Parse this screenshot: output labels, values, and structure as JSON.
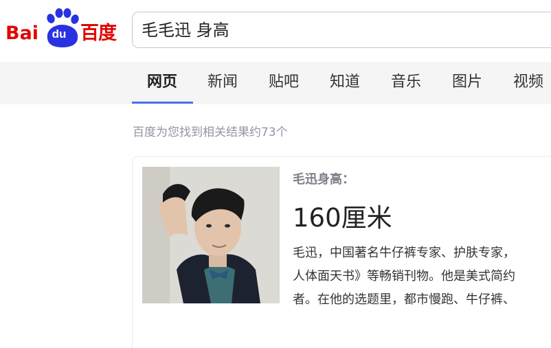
{
  "logo": {
    "bai": "Bai",
    "du": "du",
    "cn": "百度"
  },
  "search": {
    "query": "毛毛迅 身高"
  },
  "tabs": [
    {
      "label": "网页",
      "active": true
    },
    {
      "label": "新闻",
      "active": false
    },
    {
      "label": "贴吧",
      "active": false
    },
    {
      "label": "知道",
      "active": false
    },
    {
      "label": "音乐",
      "active": false
    },
    {
      "label": "图片",
      "active": false
    },
    {
      "label": "视频",
      "active": false
    }
  ],
  "result_count": "百度为您找到相关结果约73个",
  "answer": {
    "label": "毛迅身高：",
    "value": "160厘米",
    "description_lines": [
      "毛迅，中国著名牛仔裤专家、护肤专家，",
      "人体面天书》等畅销刊物。他是美式简约",
      "者。在他的选题里，都市慢跑、牛仔裤、"
    ]
  },
  "colors": {
    "brand_red": "#e10601",
    "brand_blue": "#2932e1",
    "tab_underline": "#4e6ef2"
  },
  "icons": [
    "baidu-paw-logo",
    "person-photo"
  ]
}
